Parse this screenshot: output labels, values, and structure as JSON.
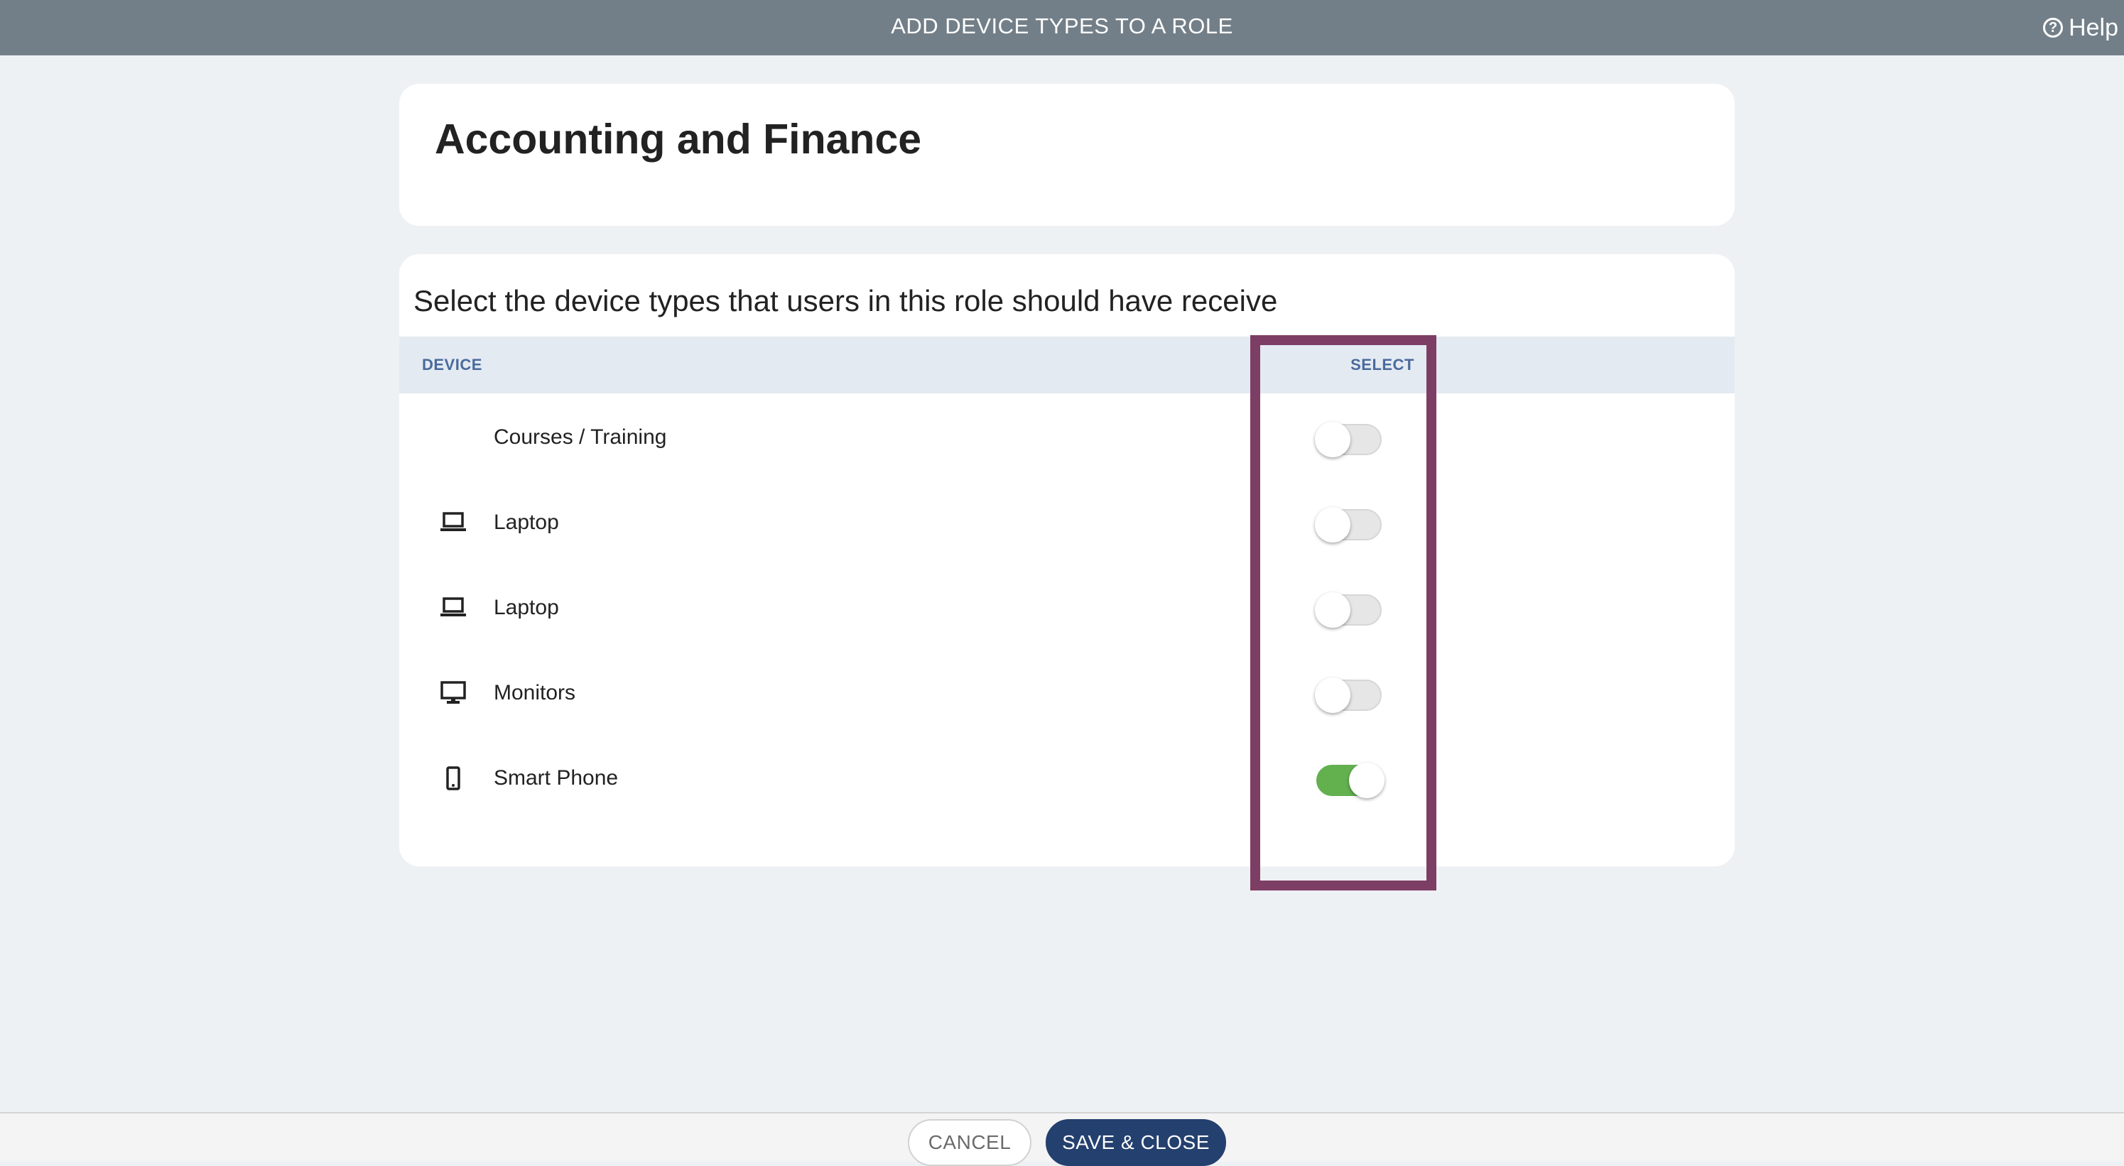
{
  "header": {
    "title": "ADD DEVICE TYPES TO A ROLE",
    "help_label": "Help",
    "help_icon": "question-circle-icon"
  },
  "role": {
    "name": "Accounting and Finance"
  },
  "device_table": {
    "instruction": "Select the device types that users in this role should have receive",
    "columns": {
      "device": "DEVICE",
      "select": "SELECT"
    },
    "rows": [
      {
        "label": "Courses / Training",
        "icon": "none",
        "selected": false
      },
      {
        "label": "Laptop",
        "icon": "laptop-icon",
        "selected": false
      },
      {
        "label": "Laptop",
        "icon": "laptop-icon",
        "selected": false
      },
      {
        "label": "Monitors",
        "icon": "monitor-icon",
        "selected": false
      },
      {
        "label": "Smart Phone",
        "icon": "smartphone-icon",
        "selected": true
      }
    ]
  },
  "footer": {
    "cancel_label": "CANCEL",
    "save_label": "SAVE & CLOSE"
  },
  "colors": {
    "header_bg": "#737f88",
    "toggle_on": "#63b04f",
    "primary_button": "#24406e",
    "highlight_box": "#7d3e65",
    "table_header_bg": "#e3eaf2",
    "table_header_text": "#4a6a9c"
  }
}
